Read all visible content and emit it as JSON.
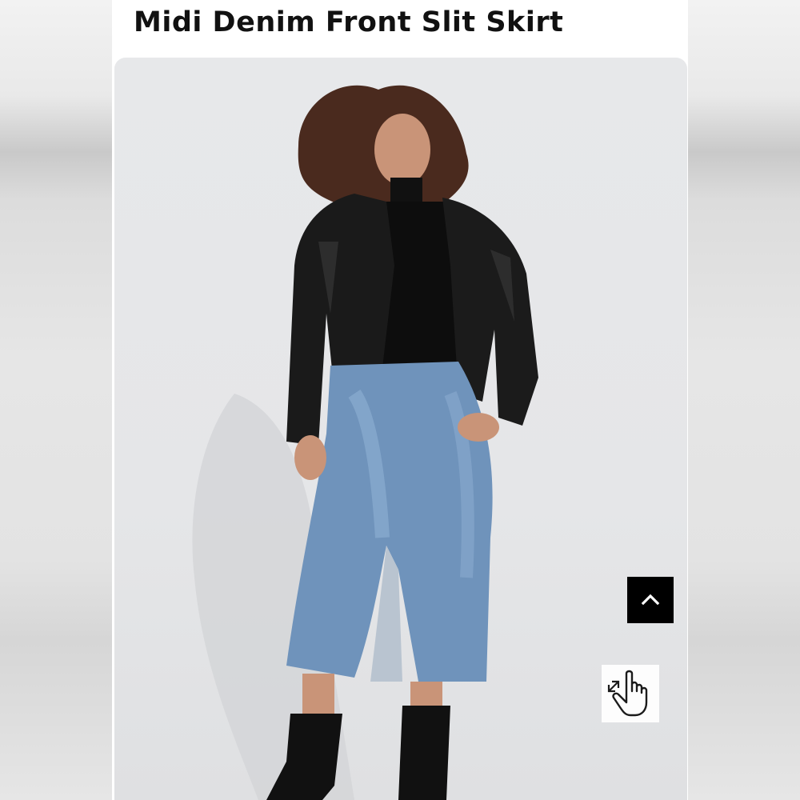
{
  "product": {
    "title": "Midi Denim Front Slit Skirt"
  },
  "controls": {
    "scroll_top_icon": "chevron-up-icon",
    "zoom_gesture_icon": "pinch-zoom-hand-icon"
  },
  "colors": {
    "page_background": "#ffffff",
    "photo_background": "#e6e7e9",
    "scroll_button_background": "#000000",
    "title_text": "#111111"
  }
}
